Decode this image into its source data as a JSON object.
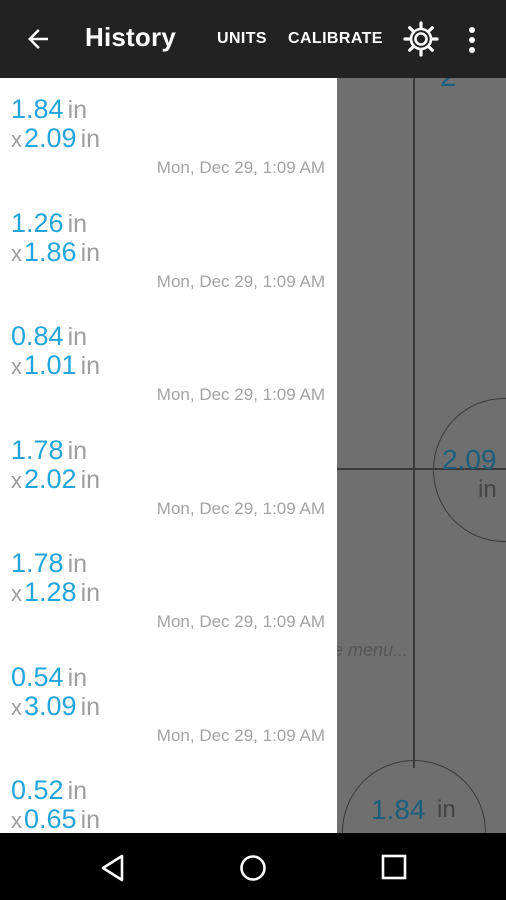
{
  "appbar": {
    "title": "History",
    "actions": {
      "units": "UNITS",
      "calibrate": "CALIBRATE"
    },
    "icons": {
      "back": "arrow-left-icon",
      "settings": "gear-icon",
      "more": "more-vert-icon"
    }
  },
  "background": {
    "top_digit": "2",
    "value_right": "2.09",
    "unit_right": "in",
    "value_bottom": "1.84",
    "unit_bottom": "in",
    "hint": "e menu..."
  },
  "history": {
    "unit": "in",
    "separator": "x",
    "entries": [
      {
        "width": "1.84",
        "height": "2.09",
        "timestamp": "Mon, Dec 29, 1:09 AM"
      },
      {
        "width": "1.26",
        "height": "1.86",
        "timestamp": "Mon, Dec 29, 1:09 AM"
      },
      {
        "width": "0.84",
        "height": "1.01",
        "timestamp": "Mon, Dec 29, 1:09 AM"
      },
      {
        "width": "1.78",
        "height": "2.02",
        "timestamp": "Mon, Dec 29, 1:09 AM"
      },
      {
        "width": "1.78",
        "height": "1.28",
        "timestamp": "Mon, Dec 29, 1:09 AM"
      },
      {
        "width": "0.54",
        "height": "3.09",
        "timestamp": "Mon, Dec 29, 1:09 AM"
      },
      {
        "width": "0.52",
        "height": "0.65",
        "timestamp": ""
      }
    ]
  },
  "navbar": {
    "icons": [
      "nav-back-icon",
      "nav-home-icon",
      "nav-recents-icon"
    ]
  },
  "colors": {
    "accent": "#23a5dc",
    "appbar": "#222222",
    "muted": "#9e9e9e"
  }
}
